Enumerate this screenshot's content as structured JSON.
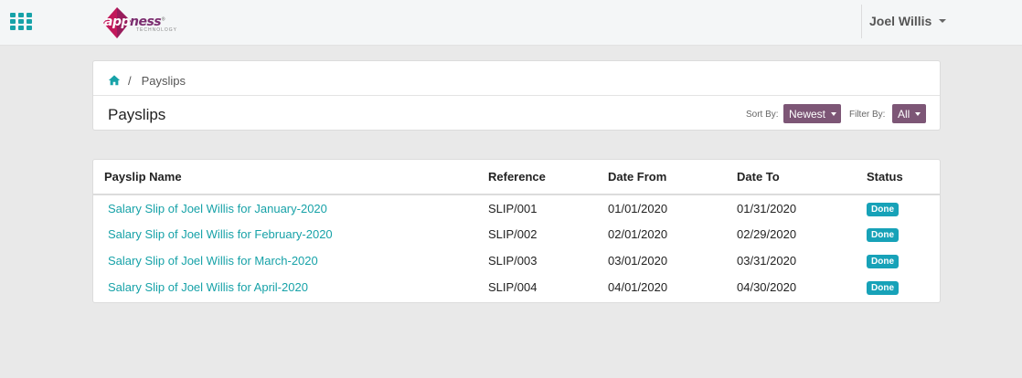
{
  "navbar": {
    "logo": {
      "text_a": "app",
      "text_b": "ness",
      "registered": "®",
      "sub": "TECHNOLOGY"
    },
    "user_name": "Joel Willis"
  },
  "header": {
    "breadcrumb_current": "Payslips",
    "title": "Payslips",
    "sort_label": "Sort By:",
    "sort_value": "Newest",
    "filter_label": "Filter By:",
    "filter_value": "All"
  },
  "table": {
    "columns": [
      "Payslip Name",
      "Reference",
      "Date From",
      "Date To",
      "Status"
    ],
    "rows": [
      {
        "name": "Salary Slip of Joel Willis for January-2020",
        "reference": "SLIP/001",
        "date_from": "01/01/2020",
        "date_to": "01/31/2020",
        "status": "Done"
      },
      {
        "name": "Salary Slip of Joel Willis for February-2020",
        "reference": "SLIP/002",
        "date_from": "02/01/2020",
        "date_to": "02/29/2020",
        "status": "Done"
      },
      {
        "name": "Salary Slip of Joel Willis for March-2020",
        "reference": "SLIP/003",
        "date_from": "03/01/2020",
        "date_to": "03/31/2020",
        "status": "Done"
      },
      {
        "name": "Salary Slip of Joel Willis for April-2020",
        "reference": "SLIP/004",
        "date_from": "04/01/2020",
        "date_to": "04/30/2020",
        "status": "Done"
      }
    ]
  },
  "colors": {
    "accent": "#17a2a8",
    "button": "#7d5676",
    "badge": "#17a2b8",
    "brand": "#7b2d6f"
  },
  "icons": [
    "apps-grid-icon",
    "home-icon",
    "caret-down-icon"
  ]
}
